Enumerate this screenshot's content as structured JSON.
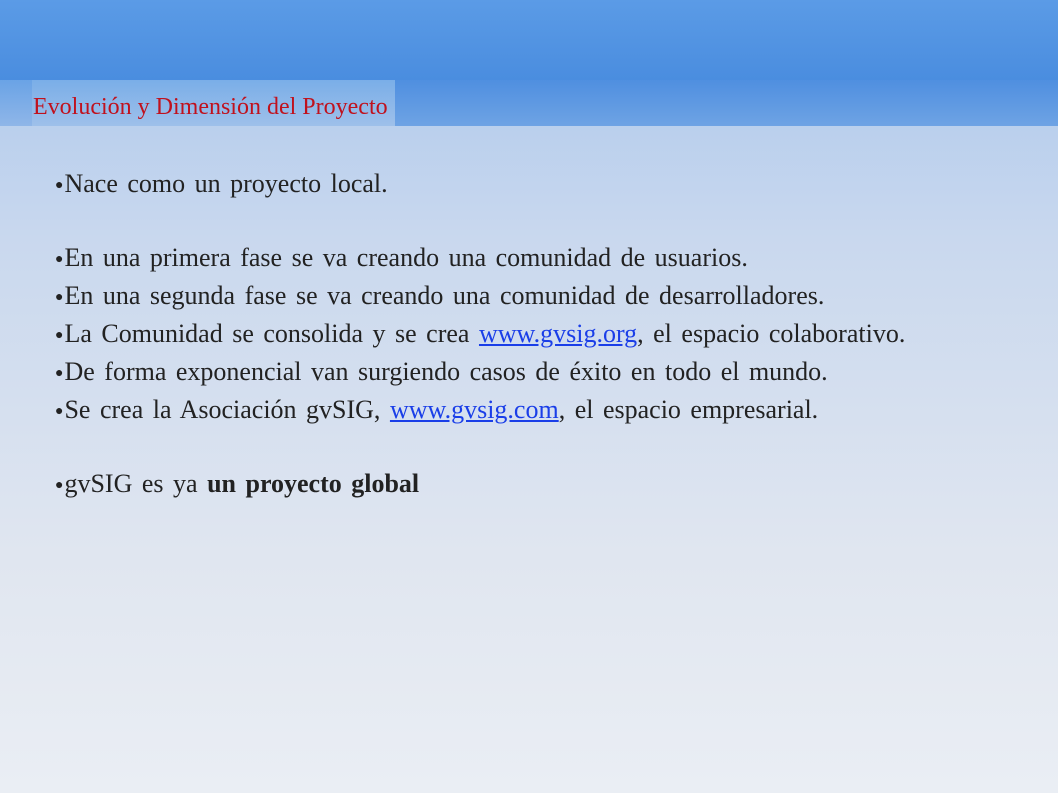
{
  "slide": {
    "title": "Evolución y Dimensión del Proyecto",
    "bullet_symbol": "●",
    "bullets": {
      "b1": {
        "text": "Nace como un proyecto local."
      },
      "b2": {
        "text": "En una primera fase se va creando una comunidad de usuarios."
      },
      "b3": {
        "text": "En una segunda fase se va creando una comunidad de desarrolladores."
      },
      "b4": {
        "pre": "La Comunidad se consolida y se crea ",
        "link": "www.gvsig.org",
        "post": ", el espacio colaborativo."
      },
      "b5": {
        "text": "De forma exponencial van surgiendo casos de éxito en todo el mundo."
      },
      "b6": {
        "pre": "Se crea la Asociación gvSIG, ",
        "link": "www.gvsig.com",
        "post": ", el espacio empresarial."
      },
      "b7": {
        "pre": "gvSIG es ya ",
        "bold": "un proyecto global"
      }
    }
  },
  "colors": {
    "title": "#c0111d",
    "link": "#1a3ee8",
    "body_text": "#222222",
    "header_band": "#4a8ddf"
  }
}
